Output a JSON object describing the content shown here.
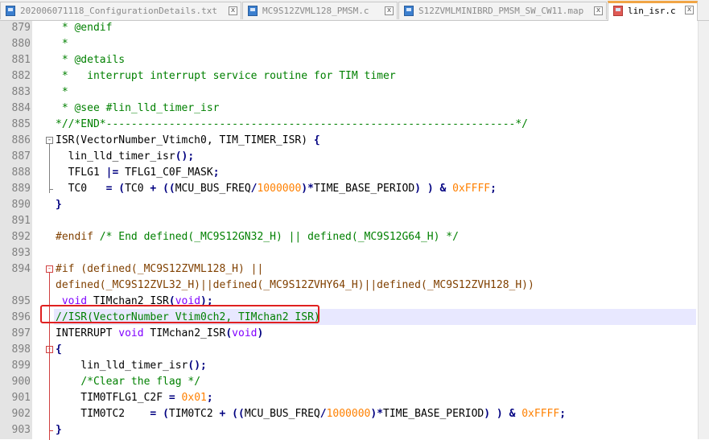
{
  "tabs": [
    {
      "label": "202006071118_ConfigurationDetails.txt",
      "close": "x",
      "active": false
    },
    {
      "label": "MC9S12ZVML128_PMSM.c",
      "close": "x",
      "active": false
    },
    {
      "label": "S12ZVMLMINIBRD_PMSM_SW_CW11.map",
      "close": "x",
      "active": false
    },
    {
      "label": "lin_isr.c",
      "close": "x",
      "active": true
    }
  ],
  "lines": [
    {
      "num": "879",
      "tokens": [
        {
          "t": " * @endif",
          "c": "c"
        }
      ]
    },
    {
      "num": "880",
      "tokens": [
        {
          "t": " *",
          "c": "c"
        }
      ]
    },
    {
      "num": "881",
      "tokens": [
        {
          "t": " * @details",
          "c": "c"
        }
      ]
    },
    {
      "num": "882",
      "tokens": [
        {
          "t": " *   interrupt interrupt service routine for TIM timer",
          "c": "c"
        }
      ]
    },
    {
      "num": "883",
      "tokens": [
        {
          "t": " *",
          "c": "c"
        }
      ]
    },
    {
      "num": "884",
      "tokens": [
        {
          "t": " * @see #lin_lld_timer_isr",
          "c": "c"
        }
      ]
    },
    {
      "num": "885",
      "tokens": [
        {
          "t": "*//*END*-----------------------------------------------------------------*/",
          "c": "c"
        }
      ]
    },
    {
      "num": "886",
      "tokens": [
        {
          "t": "ISR(VectorNumber_Vtimch0, TIM_TIMER_ISR) ",
          "c": ""
        },
        {
          "t": "{",
          "c": "p"
        }
      ]
    },
    {
      "num": "887",
      "tokens": [
        {
          "t": "  lin_lld_timer_isr",
          "c": ""
        },
        {
          "t": "();",
          "c": "p"
        }
      ]
    },
    {
      "num": "888",
      "tokens": [
        {
          "t": "  TFLG1 ",
          "c": ""
        },
        {
          "t": "|=",
          "c": "p"
        },
        {
          "t": " TFLG1_C0F_MASK",
          "c": ""
        },
        {
          "t": ";",
          "c": "p"
        }
      ]
    },
    {
      "num": "889",
      "tokens": [
        {
          "t": "  TC0   ",
          "c": ""
        },
        {
          "t": "=",
          "c": "p"
        },
        {
          "t": " ",
          "c": ""
        },
        {
          "t": "(",
          "c": "p"
        },
        {
          "t": "TC0 ",
          "c": ""
        },
        {
          "t": "+",
          "c": "p"
        },
        {
          "t": " ",
          "c": ""
        },
        {
          "t": "((",
          "c": "p"
        },
        {
          "t": "MCU_BUS_FREQ",
          "c": ""
        },
        {
          "t": "/",
          "c": "p"
        },
        {
          "t": "1000000",
          "c": "n"
        },
        {
          "t": ")",
          "c": "p"
        },
        {
          "t": "*",
          "c": "p"
        },
        {
          "t": "TIME_BASE_PERIOD",
          "c": ""
        },
        {
          "t": ")",
          "c": "p"
        },
        {
          "t": " ",
          "c": ""
        },
        {
          "t": ")",
          "c": "p"
        },
        {
          "t": " ",
          "c": ""
        },
        {
          "t": "&",
          "c": "p"
        },
        {
          "t": " ",
          "c": ""
        },
        {
          "t": "0xFFFF",
          "c": "n"
        },
        {
          "t": ";",
          "c": "p"
        }
      ]
    },
    {
      "num": "890",
      "tokens": [
        {
          "t": "}",
          "c": "p"
        }
      ]
    },
    {
      "num": "891",
      "tokens": []
    },
    {
      "num": "892",
      "tokens": [
        {
          "t": "#endif",
          "c": "pre"
        },
        {
          "t": " ",
          "c": ""
        },
        {
          "t": "/* End defined(_MC9S12GN32_H) || defined(_MC9S12G64_H) */",
          "c": "c"
        }
      ]
    },
    {
      "num": "893",
      "tokens": []
    },
    {
      "num": "894",
      "tokens": [
        {
          "t": "#if (defined(_MC9S12ZVML128_H) ||",
          "c": "pre"
        }
      ]
    },
    {
      "num": "",
      "tokens": [
        {
          "t": "defined(_MC9S12ZVL32_H)||defined(_MC9S12ZVHY64_H)||defined(_MC9S12ZVH128_H))",
          "c": "pre"
        }
      ]
    },
    {
      "num": "895",
      "tokens": [
        {
          "t": " ",
          "c": ""
        },
        {
          "t": "void",
          "c": "k"
        },
        {
          "t": " TIMchan2_ISR",
          "c": ""
        },
        {
          "t": "(",
          "c": "p"
        },
        {
          "t": "void",
          "c": "k"
        },
        {
          "t": ");",
          "c": "p"
        }
      ]
    },
    {
      "num": "896",
      "tokens": [
        {
          "t": "//ISR(VectorNumber_Vtim0ch2, TIMchan2_ISR)",
          "c": "c"
        }
      ]
    },
    {
      "num": "897",
      "tokens": [
        {
          "t": "INTERRUPT ",
          "c": ""
        },
        {
          "t": "void",
          "c": "k"
        },
        {
          "t": " TIMchan2_ISR",
          "c": ""
        },
        {
          "t": "(",
          "c": "p"
        },
        {
          "t": "void",
          "c": "k"
        },
        {
          "t": ")",
          "c": "p"
        }
      ]
    },
    {
      "num": "898",
      "tokens": [
        {
          "t": "{",
          "c": "p"
        }
      ]
    },
    {
      "num": "899",
      "tokens": [
        {
          "t": "    lin_lld_timer_isr",
          "c": ""
        },
        {
          "t": "();",
          "c": "p"
        }
      ]
    },
    {
      "num": "900",
      "tokens": [
        {
          "t": "    ",
          "c": ""
        },
        {
          "t": "/*Clear the flag */",
          "c": "c"
        }
      ]
    },
    {
      "num": "901",
      "tokens": [
        {
          "t": "    TIM0TFLG1_C2F ",
          "c": ""
        },
        {
          "t": "=",
          "c": "p"
        },
        {
          "t": " ",
          "c": ""
        },
        {
          "t": "0x01",
          "c": "n"
        },
        {
          "t": ";",
          "c": "p"
        }
      ]
    },
    {
      "num": "902",
      "tokens": [
        {
          "t": "    TIM0TC2    ",
          "c": ""
        },
        {
          "t": "=",
          "c": "p"
        },
        {
          "t": " ",
          "c": ""
        },
        {
          "t": "(",
          "c": "p"
        },
        {
          "t": "TIM0TC2 ",
          "c": ""
        },
        {
          "t": "+",
          "c": "p"
        },
        {
          "t": " ",
          "c": ""
        },
        {
          "t": "((",
          "c": "p"
        },
        {
          "t": "MCU_BUS_FREQ",
          "c": ""
        },
        {
          "t": "/",
          "c": "p"
        },
        {
          "t": "1000000",
          "c": "n"
        },
        {
          "t": ")",
          "c": "p"
        },
        {
          "t": "*",
          "c": "p"
        },
        {
          "t": "TIME_BASE_PERIOD",
          "c": ""
        },
        {
          "t": ")",
          "c": "p"
        },
        {
          "t": " ",
          "c": ""
        },
        {
          "t": ")",
          "c": "p"
        },
        {
          "t": " ",
          "c": ""
        },
        {
          "t": "&",
          "c": "p"
        },
        {
          "t": " ",
          "c": ""
        },
        {
          "t": "0xFFFF",
          "c": "n"
        },
        {
          "t": ";",
          "c": "p"
        }
      ]
    },
    {
      "num": "903",
      "tokens": [
        {
          "t": "}",
          "c": "p"
        }
      ]
    }
  ],
  "fold_markers": [
    {
      "line": 7,
      "sign": "-",
      "color": "gray"
    },
    {
      "line": 15,
      "sign": "-",
      "color": "red"
    },
    {
      "line": 20,
      "sign": "-",
      "color": "red"
    }
  ],
  "colors": {
    "comment": "#008000",
    "number": "#ff8000",
    "keyword": "#8000ff",
    "operator": "#000080",
    "preprocessor": "#804000",
    "current_line": "#e8e8ff",
    "annotation_box": "#e02020",
    "active_tab_accent": "#f1a545"
  }
}
